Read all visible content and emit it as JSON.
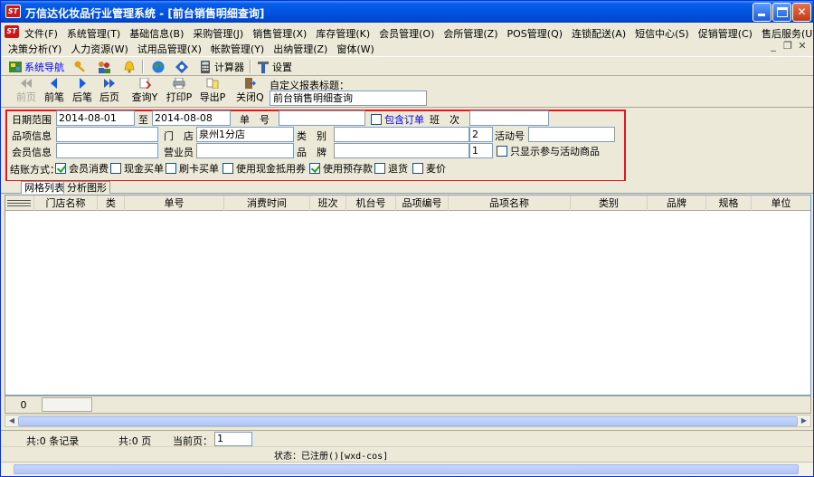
{
  "window": {
    "app_icon": "app-logo-icon",
    "title": "万信达化妆品行业管理系统 - [前台销售明细查询]",
    "colors": {
      "titlebar": "#0054e3",
      "highlight_box": "#e8141e",
      "link_blue": "#0000ff"
    }
  },
  "menu": {
    "row1": [
      "文件(F)",
      "系统管理(T)",
      "基础信息(B)",
      "采购管理(J)",
      "销售管理(X)",
      "库存管理(K)",
      "会员管理(O)",
      "会所管理(Z)",
      "POS管理(Q)",
      "连锁配送(A)",
      "短信中心(S)",
      "促销管理(C)",
      "售后服务(U)"
    ],
    "row2": [
      "决策分析(Y)",
      "人力资源(W)",
      "试用品管理(X)",
      "帐款管理(Y)",
      "出纳管理(Z)",
      "窗体(W)"
    ]
  },
  "toolbar1": {
    "nav_label": "系统导航",
    "calculator_label": "计算器",
    "settings_label": "设置"
  },
  "toolbar2": {
    "prev_page": "前页",
    "first": "前笔",
    "next": "后笔",
    "last_page": "后页",
    "query": "查询Y",
    "print": "打印P",
    "export": "导出P",
    "close": "关闭Q",
    "custom_title_label": "自定义报表标题：",
    "custom_title_value": "前台销售明细查询"
  },
  "filters": {
    "date_range_label": "日期范围",
    "date_from": "2014-08-01",
    "date_to_label": "至",
    "date_to": "2014-08-08",
    "order_no_label": "单　号",
    "order_no": "",
    "include_orders_label": "包含订单",
    "shift_label": "班　次",
    "shift": "",
    "item_info_label": "品项信息",
    "item_info": "",
    "store_label": "门　店",
    "store": "泉州1分店",
    "category_label": "类　别",
    "category": "",
    "category_level": "2",
    "activity_no_label": "活动号",
    "activity_no": "",
    "member_info_label": "会员信息",
    "member_info": "",
    "salesperson_label": "营业员",
    "salesperson": "",
    "brand_label": "品　牌",
    "brand": "",
    "brand_level": "1",
    "only_promo_label": "只显示参与活动商品",
    "payment_label": "结账方式：",
    "payments": [
      {
        "label": "会员消费",
        "checked": true
      },
      {
        "label": "现金买单",
        "checked": false
      },
      {
        "label": "刷卡买单",
        "checked": false
      },
      {
        "label": "使用现金抵用券",
        "checked": false
      },
      {
        "label": "使用预存款",
        "checked": true
      },
      {
        "label": "退货",
        "checked": false
      },
      {
        "label": "麦价",
        "checked": false
      }
    ]
  },
  "tabs": [
    "网格列表",
    "分析图形"
  ],
  "grid": {
    "columns": [
      "门店名称",
      "类",
      "单号",
      "消费时间",
      "班次",
      "机台号",
      "品项编号",
      "品项名称",
      "类别",
      "品牌",
      "规格",
      "单位"
    ],
    "footer_count": "0"
  },
  "status": {
    "total_records": "共:0 条记录",
    "total_pages": "共:0 页",
    "current_page_label": "当前页：",
    "current_page": "1",
    "registration": "状态：已注册()[wxd-cos]"
  }
}
